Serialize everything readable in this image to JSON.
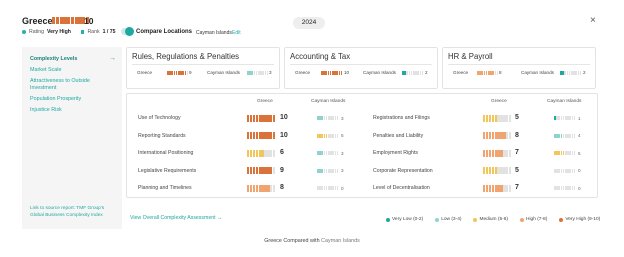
{
  "header": {
    "country": "Greece",
    "score": "10",
    "score_level": 10,
    "rating_label": "Rating",
    "rating_value": "Very High",
    "rank_label": "Rank",
    "rank_value": "1 / 75",
    "compare_label": "Compare Locations",
    "compare_location": "Cayman Islands",
    "edit_label": "Edit",
    "year": "2024",
    "close": "×"
  },
  "sidebar": {
    "items": [
      {
        "label": "Complexity Levels",
        "active": true
      },
      {
        "label": "Market Scale"
      },
      {
        "label": "Attractiveness to Outside Investment"
      },
      {
        "label": "Population Prosperity"
      },
      {
        "label": "Injustice Risk"
      }
    ],
    "arrow": "→",
    "footer": "Link to source report: TMF Group's Global Business Complexity Index"
  },
  "cards": [
    {
      "title": "Rules, Regulations & Penalties",
      "a_label": "Greece",
      "a_score": "9",
      "a_level": 9,
      "b_label": "Cayman Islands",
      "b_score": "3",
      "b_level": 3
    },
    {
      "title": "Accounting & Tax",
      "a_label": "Greece",
      "a_score": "10",
      "a_level": 10,
      "b_label": "Cayman Islands",
      "b_score": "2",
      "b_level": 2
    },
    {
      "title": "HR & Payroll",
      "a_label": "Greece",
      "a_score": "8",
      "a_level": 8,
      "b_label": "Cayman Islands",
      "b_score": "2",
      "b_level": 2
    }
  ],
  "panel": {
    "col_a": "Greece",
    "col_b": "Cayman Islands",
    "left_rows": [
      {
        "label": "Use of Technology",
        "a": "10",
        "a_level": 10,
        "b": "3",
        "b_level": 3
      },
      {
        "label": "Reporting Standards",
        "a": "10",
        "a_level": 10,
        "b": "5",
        "b_level": 5
      },
      {
        "label": "International Positioning",
        "a": "6",
        "a_level": 6,
        "b": "3",
        "b_level": 3
      },
      {
        "label": "Legislative Requirements",
        "a": "9",
        "a_level": 9,
        "b": "3",
        "b_level": 3
      },
      {
        "label": "Planning and Timelines",
        "a": "8",
        "a_level": 8,
        "b": "0",
        "b_level": 0
      }
    ],
    "right_rows": [
      {
        "label": "Registrations and Filings",
        "a": "5",
        "a_level": 5,
        "b": "1",
        "b_level": 1
      },
      {
        "label": "Penalties and Liability",
        "a": "8",
        "a_level": 8,
        "b": "4",
        "b_level": 4
      },
      {
        "label": "Employment Rights",
        "a": "7",
        "a_level": 7,
        "b": "5",
        "b_level": 5
      },
      {
        "label": "Corporate Representation",
        "a": "5",
        "a_level": 5,
        "b": "0",
        "b_level": 0
      },
      {
        "label": "Level of Decentralisation",
        "a": "7",
        "a_level": 7,
        "b": "0",
        "b_level": 0
      }
    ]
  },
  "view_all": "View Overall Complexity Assessment →",
  "legend": [
    {
      "label": "Very Low (0-2)",
      "color": "#1ea8a0"
    },
    {
      "label": "Low (3-4)",
      "color": "#8fd3cf"
    },
    {
      "label": "Medium (5-6)",
      "color": "#f1c75b"
    },
    {
      "label": "High (7-8)",
      "color": "#f0a46f"
    },
    {
      "label": "Very High (9-10)",
      "color": "#d9733a"
    }
  ],
  "footer": {
    "prefix": "Greece Compared with",
    "location": "Cayman Islands"
  },
  "colors": {
    "very_low": "#1ea8a0",
    "low": "#8fd3cf",
    "medium": "#f1c75b",
    "high": "#f0a46f",
    "very_high": "#d9733a",
    "empty": "#e2e2e2",
    "accent": "#1ea8a0"
  }
}
